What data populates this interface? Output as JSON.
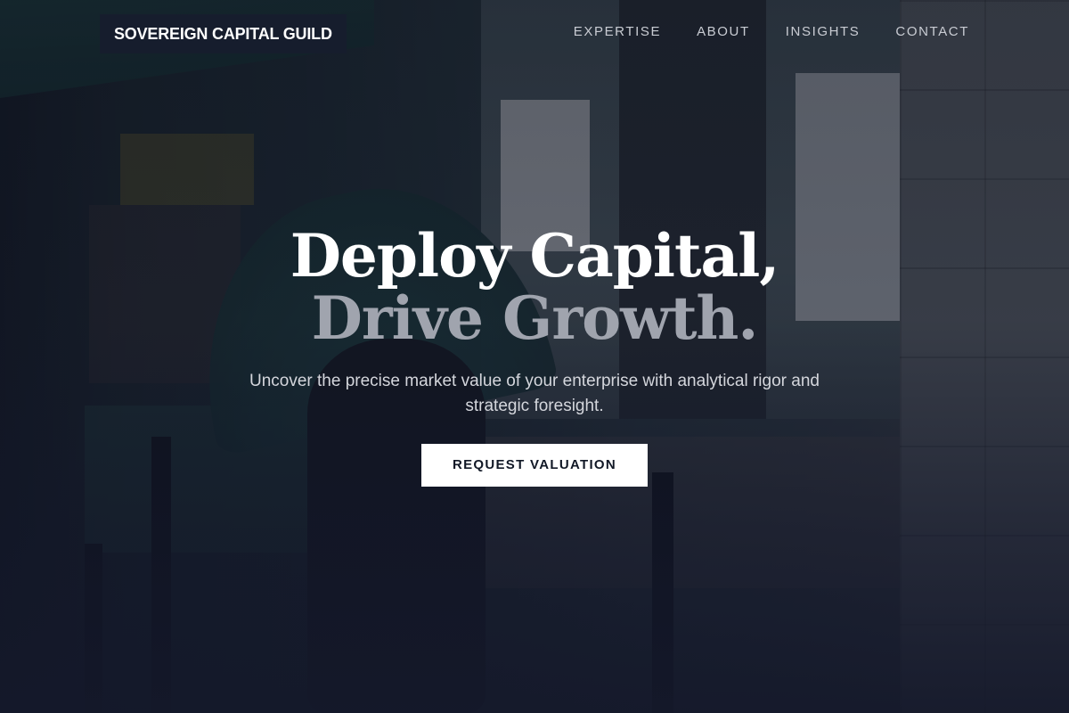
{
  "header": {
    "brand": "SOVEREIGN CAPITAL GUILD",
    "nav": [
      {
        "label": "EXPERTISE"
      },
      {
        "label": "ABOUT"
      },
      {
        "label": "INSIGHTS"
      },
      {
        "label": "CONTACT"
      }
    ]
  },
  "hero": {
    "headline_line1": "Deploy Capital,",
    "headline_line2": "Drive Growth.",
    "subtitle": "Uncover the precise market value of your enterprise with analytical rigor and strategic foresight.",
    "cta_label": "REQUEST VALUATION"
  },
  "colors": {
    "overlay": "#121628",
    "brand_bg": "#161d2d",
    "headline_primary": "#ffffff",
    "headline_secondary": "#a0a4ae",
    "cta_bg": "#ffffff",
    "cta_text": "#111826"
  }
}
